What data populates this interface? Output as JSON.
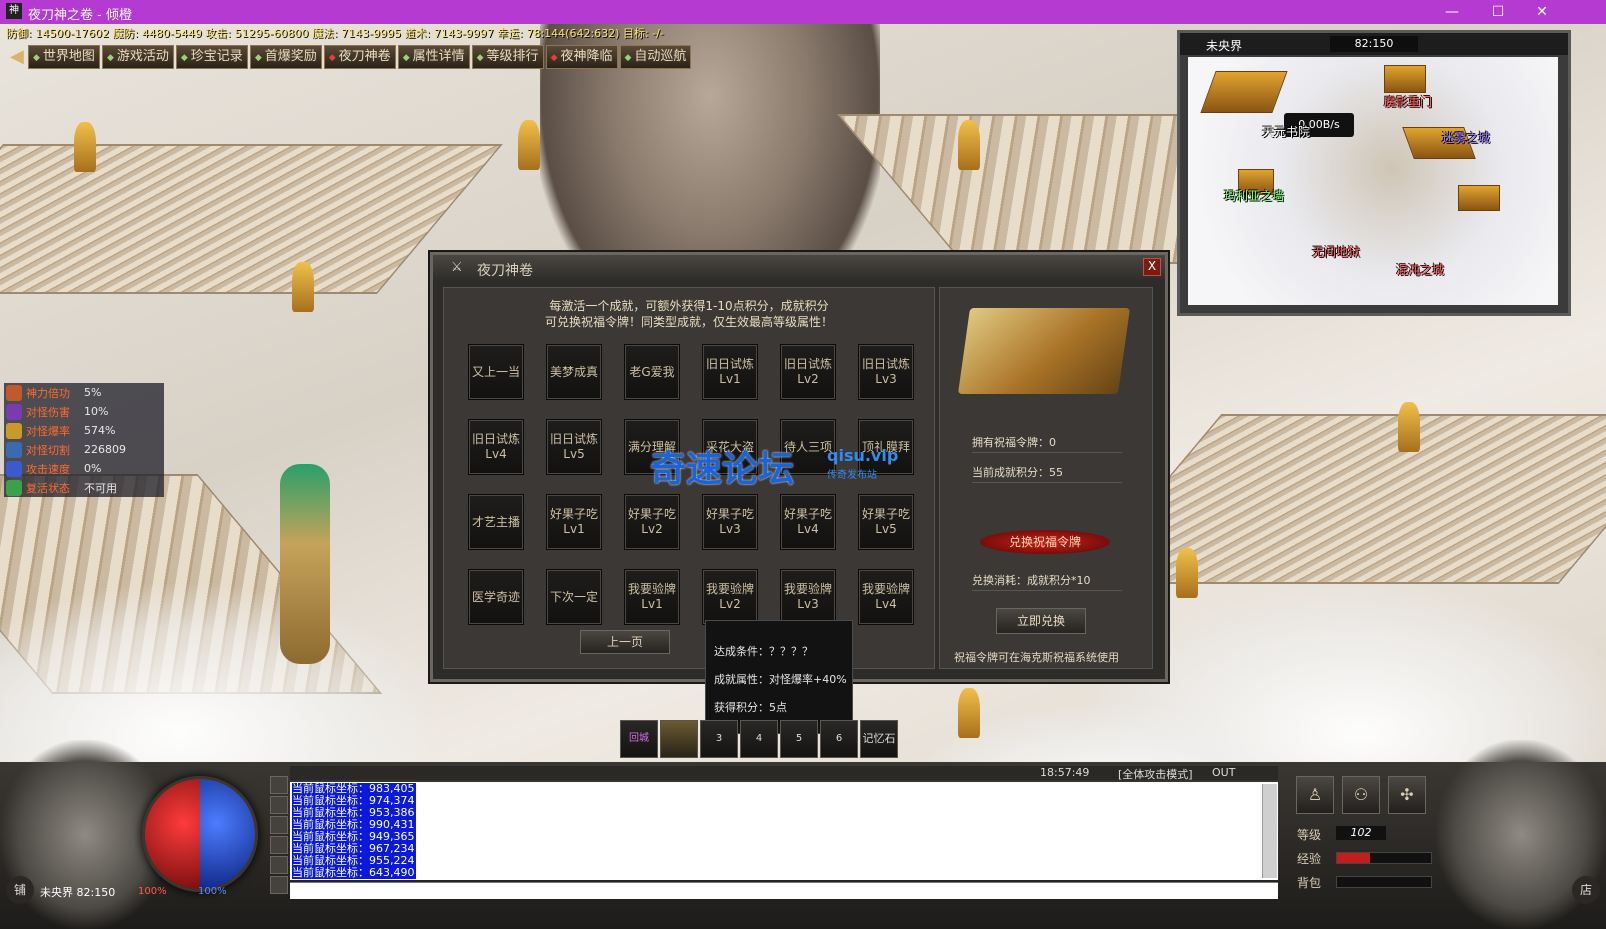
{
  "window": {
    "title": "夜刀神之卷 - 倾橙",
    "icon_text": "神"
  },
  "stats_line": "防御: 14500-17602 魔防: 4480-5449 攻击: 51295-60800 魔法: 7143-9995 道术: 7143-9997 幸运: 78:144(642:632) 目标: -/-",
  "nav": [
    "世界地图",
    "游戏活动",
    "珍宝记录",
    "首爆奖励",
    "夜刀神卷",
    "属性详情",
    "等级排行",
    "夜神降临",
    "自动巡航"
  ],
  "minimap": {
    "zone": "未央界",
    "coords": "82:150",
    "speed": "0.00B/s",
    "labels": [
      {
        "text": "天元书院",
        "color": "#ffffff"
      },
      {
        "text": "魔影重门",
        "color": "#ff5a5a"
      },
      {
        "text": "迷雾之城",
        "color": "#9c7bff"
      },
      {
        "text": "玛利亚之墙",
        "color": "#7cff7c"
      },
      {
        "text": "无间地狱",
        "color": "#ff5a5a"
      },
      {
        "text": "混沌之城",
        "color": "#ff5a5a"
      }
    ]
  },
  "buffs": [
    {
      "label": "神力倍功",
      "value": "5%",
      "color": "#c05a2a"
    },
    {
      "label": "对怪伤害",
      "value": "10%",
      "color": "#7a3ab0"
    },
    {
      "label": "对怪爆率",
      "value": "574%",
      "color": "#c89a2a"
    },
    {
      "label": "对怪切割",
      "value": "226809",
      "color": "#3a6ab0"
    },
    {
      "label": "攻击速度",
      "value": "0%",
      "color": "#3a5ad0"
    },
    {
      "label": "复活状态",
      "value": "不可用",
      "color": "#3aa04a"
    }
  ],
  "dialog": {
    "title": "夜刀神卷",
    "close": "X",
    "intro_1": "每激活一个成就，可额外获得1-10点积分，成就积分",
    "intro_2": "可兑换祝福令牌！同类型成就，仅生效最高等级属性！",
    "achievements": [
      [
        "又上一当"
      ],
      [
        "美梦成真"
      ],
      [
        "老G爱我"
      ],
      [
        "旧日试炼",
        "Lv1"
      ],
      [
        "旧日试炼",
        "Lv2"
      ],
      [
        "旧日试炼",
        "Lv3"
      ],
      [
        "旧日试炼",
        "Lv4"
      ],
      [
        "旧日试炼",
        "Lv5"
      ],
      [
        "满分理解"
      ],
      [
        "采花大盗"
      ],
      [
        "待人三项"
      ],
      [
        "顶礼膜拜"
      ],
      [
        "才艺主播"
      ],
      [
        "好果子吃",
        "Lv1"
      ],
      [
        "好果子吃",
        "Lv2"
      ],
      [
        "好果子吃",
        "Lv3"
      ],
      [
        "好果子吃",
        "Lv4"
      ],
      [
        "好果子吃",
        "Lv5"
      ],
      [
        "医学奇迹"
      ],
      [
        "下次一定"
      ],
      [
        "我要验牌",
        "Lv1"
      ],
      [
        "我要验牌",
        "Lv2"
      ],
      [
        "我要验牌",
        "Lv3"
      ],
      [
        "我要验牌",
        "Lv4"
      ]
    ],
    "prev_page": "上一页",
    "owned_tokens": "拥有祝福令牌：0",
    "current_points": "当前成就积分：55",
    "exchange_title": "兑换祝福令牌",
    "exchange_cost": "兑换消耗：成就积分*10",
    "exchange_now": "立即兑换",
    "note": "祝福令牌可在海克斯祝福系统使用"
  },
  "tooltip": {
    "condition": "达成条件：？？？？",
    "attribute": "成就属性：对怪爆率+40%",
    "points": "获得积分：5点"
  },
  "watermark": {
    "main": "奇速论坛",
    "url": "qisu.vip",
    "sub": "传奇发布站"
  },
  "skills": [
    "回城",
    "",
    "3",
    "4",
    "5",
    "6",
    "记忆石"
  ],
  "chat": {
    "lines": [
      "当前鼠标坐标：983,405",
      "当前鼠标坐标：974,374",
      "当前鼠标坐标：953,386",
      "当前鼠标坐标：990,431",
      "当前鼠标坐标：949,365",
      "当前鼠标坐标：967,234",
      "当前鼠标坐标：955,224",
      "当前鼠标坐标：643,490"
    ],
    "time": "18:57:49",
    "mode": "[全体攻击模式]",
    "out": "OUT"
  },
  "player": {
    "location": "未央界 82:150",
    "hp": "100%",
    "mp": "100%"
  },
  "right_stats": {
    "level_label": "等级",
    "level": "102",
    "exp_label": "经验",
    "bag_label": "背包",
    "exp_fill": 0.35
  },
  "corner": {
    "shop_left": "铺",
    "shop_right": "店"
  }
}
